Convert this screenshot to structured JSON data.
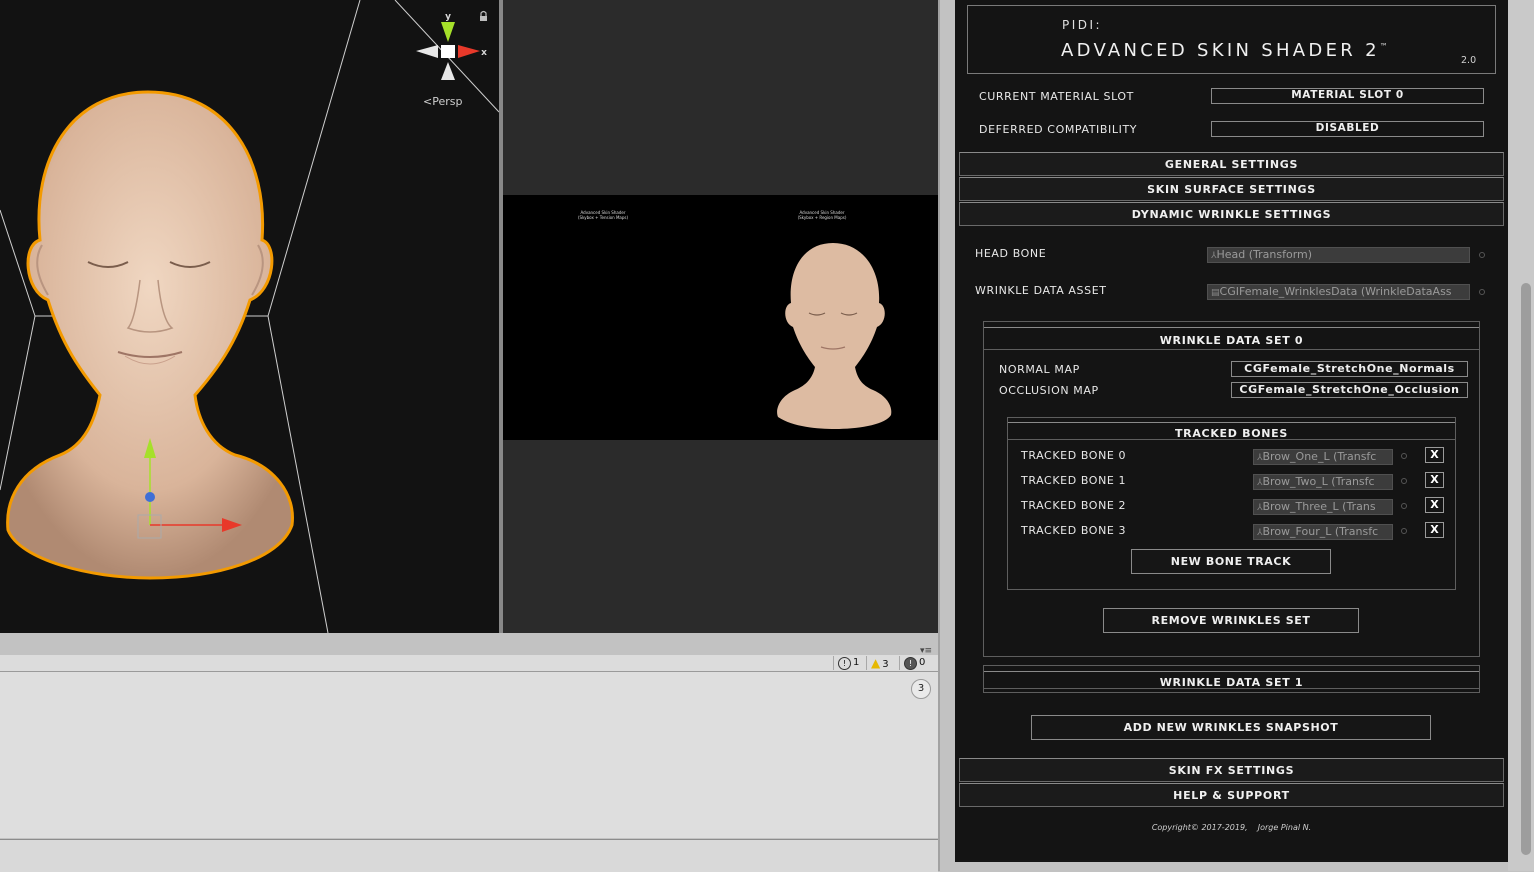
{
  "scene_view": {
    "gizmo": {
      "y_axis": "y",
      "x_axis": "x",
      "projection": "Persp"
    }
  },
  "game_view": {
    "left_caption": {
      "line1": "Advanced Skin Shader",
      "line2": "(Skybox + Tension Maps)"
    },
    "right_caption": {
      "line1": "Advanced Skin Shader",
      "line2": "(Skybox + Region Maps)"
    }
  },
  "console": {
    "info_count": "1",
    "warning_count": "3",
    "error_count": "0",
    "collapse_count": "3"
  },
  "inspector": {
    "header": {
      "brand": "PIDI:",
      "product": "ADVANCED SKIN SHADER 2",
      "trademark": "™",
      "version": "2.0"
    },
    "current_material_slot": {
      "label": "CURRENT MATERIAL SLOT",
      "value": "MATERIAL SLOT 0"
    },
    "deferred_compatibility": {
      "label": "DEFERRED COMPATIBILITY",
      "value": "DISABLED"
    },
    "sections": {
      "general": "GENERAL SETTINGS",
      "surface": "SKIN SURFACE SETTINGS",
      "wrinkles": "DYNAMIC WRINKLE SETTINGS",
      "fx": "SKIN FX SETTINGS",
      "help": "HELP & SUPPORT"
    },
    "head_bone": {
      "label": "HEAD BONE",
      "value": "Head (Transform)"
    },
    "wrinkle_data_asset": {
      "label": "WRINKLE DATA ASSET",
      "value": "CGIFemale_WrinklesData (WrinkleDataAss"
    },
    "wrinkle_set_0": {
      "title": "WRINKLE DATA SET 0",
      "normal_map": {
        "label": "NORMAL MAP",
        "value": "CGFemale_StretchOne_Normals"
      },
      "occlusion_map": {
        "label": "OCCLUSION MAP",
        "value": "CGFemale_StretchOne_Occlusion"
      },
      "tracked_bones": {
        "title": "TRACKED BONES",
        "items": [
          {
            "label": "TRACKED BONE 0",
            "value": "Brow_One_L (Transfc",
            "remove": "X"
          },
          {
            "label": "TRACKED BONE 1",
            "value": "Brow_Two_L (Transfc",
            "remove": "X"
          },
          {
            "label": "TRACKED BONE 2",
            "value": "Brow_Three_L (Trans",
            "remove": "X"
          },
          {
            "label": "TRACKED BONE 3",
            "value": "Brow_Four_L (Transfc",
            "remove": "X"
          }
        ],
        "new_button": "NEW BONE TRACK"
      },
      "remove_button": "REMOVE WRINKLES SET"
    },
    "wrinkle_set_1": {
      "title": "WRINKLE DATA SET 1"
    },
    "add_snapshot_button": "ADD NEW WRINKLES SNAPSHOT",
    "copyright": "Copyright© 2017-2019,    Jorge Pinal N."
  },
  "colors": {
    "selection_outline": "#f39a00",
    "axis_x": "#e8392a",
    "axis_y": "#a6e02a",
    "axis_z": "#3f6fd6",
    "skin": "#e3c2aa",
    "inspector_bg": "#141414"
  }
}
